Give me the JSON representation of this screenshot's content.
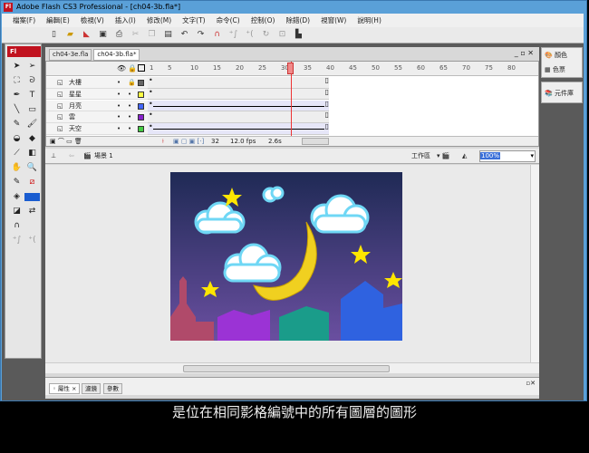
{
  "window": {
    "title": "Adobe Flash CS3 Professional - [ch04-3b.fla*]",
    "logo": "Fl"
  },
  "menu": [
    "檔案(F)",
    "編輯(E)",
    "檢視(V)",
    "插入(I)",
    "修改(M)",
    "文字(T)",
    "命令(C)",
    "控制(O)",
    "除錯(D)",
    "視窗(W)",
    "說明(H)"
  ],
  "toolbar_icons": [
    "new-icon",
    "open-icon",
    "bridge-icon",
    "save-icon",
    "print-icon",
    "cut-icon",
    "copy-icon",
    "paste-icon",
    "undo-icon",
    "redo-icon",
    "snap-icon",
    "smooth-icon",
    "straighten-icon",
    "rotate-icon",
    "scale-icon",
    "align-icon"
  ],
  "tools": {
    "logo": "Fl"
  },
  "doc_tabs": [
    "ch04-3e.fla",
    "ch04-3b.fla*"
  ],
  "timeline": {
    "frame_numbers": [
      "1",
      "5",
      "10",
      "15",
      "20",
      "25",
      "30",
      "35",
      "40",
      "45",
      "50",
      "55",
      "60",
      "65",
      "70",
      "75",
      "80"
    ],
    "layers": [
      {
        "name": "大樓",
        "color": "#666666",
        "locked": true
      },
      {
        "name": "星星",
        "color": "#ffff44",
        "locked": false
      },
      {
        "name": "月亮",
        "color": "#4466ff",
        "locked": false
      },
      {
        "name": "雲",
        "color": "#8822cc",
        "locked": false
      },
      {
        "name": "天空",
        "color": "#44cc44",
        "locked": false
      }
    ],
    "current_frame": "32",
    "fps": "12.0 fps",
    "time": "2.6s"
  },
  "editbar": {
    "scene": "場景 1",
    "workspace": "工作區",
    "zoom": "100%"
  },
  "right_panel": {
    "color": "顏色",
    "swatches": "色票",
    "library": "元件庫"
  },
  "bottom_tabs": [
    "屬性",
    "濾鏡",
    "參數"
  ],
  "subtitle": "是位在相同影格編號中的所有圖層的圖形"
}
